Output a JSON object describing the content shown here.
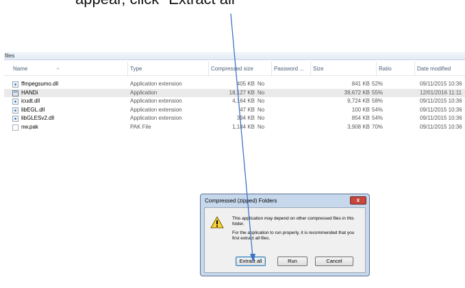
{
  "caption": {
    "text": "appear, click \"Extract all\""
  },
  "explorer": {
    "path": "files",
    "columns": {
      "name": "Name",
      "type": "Type",
      "compressed": "Compressed size",
      "password": "Password ...",
      "size": "Size",
      "ratio": "Ratio",
      "date": "Date modified"
    },
    "files": [
      {
        "name": "ffmpegsumo.dll",
        "type": "Application extension",
        "compressed": "405 KB",
        "password": "No",
        "size": "841 KB",
        "ratio": "52%",
        "date": "09/11/2015 10:36",
        "icon": "dll-file-icon"
      },
      {
        "name": "HANDi",
        "type": "Application",
        "compressed": "18,127 KB",
        "password": "No",
        "size": "39,672 KB",
        "ratio": "55%",
        "date": "12/01/2016 11:11",
        "icon": "application-icon",
        "selected": true
      },
      {
        "name": "icudt.dll",
        "type": "Application extension",
        "compressed": "4,164 KB",
        "password": "No",
        "size": "9,724 KB",
        "ratio": "58%",
        "date": "09/11/2015 10:36",
        "icon": "dll-file-icon"
      },
      {
        "name": "libEGL.dll",
        "type": "Application extension",
        "compressed": "47 KB",
        "password": "No",
        "size": "100 KB",
        "ratio": "54%",
        "date": "09/11/2015 10:36",
        "icon": "dll-file-icon"
      },
      {
        "name": "libGLESv2.dll",
        "type": "Application extension",
        "compressed": "394 KB",
        "password": "No",
        "size": "854 KB",
        "ratio": "54%",
        "date": "09/11/2015 10:36",
        "icon": "dll-file-icon"
      },
      {
        "name": "nw.pak",
        "type": "PAK File",
        "compressed": "1,184 KB",
        "password": "No",
        "size": "3,908 KB",
        "ratio": "70%",
        "date": "09/11/2015 10:36",
        "icon": "blank-file-icon"
      }
    ]
  },
  "dialog": {
    "title": "Compressed (zipped) Folders",
    "close_label": "x",
    "message1": "This application may depend on other compressed files in this folder.",
    "message2": "For the application to run properly, it is recommended that you first extract all files.",
    "buttons": {
      "extract": "Extract all",
      "run": "Run",
      "cancel": "Cancel"
    },
    "icon": "warning-icon"
  },
  "colors": {
    "arrow": "#3f72c4",
    "dialog_frame": "#c7d8ed",
    "close_button": "#c8473c",
    "selected_row": "#eaeaea"
  }
}
